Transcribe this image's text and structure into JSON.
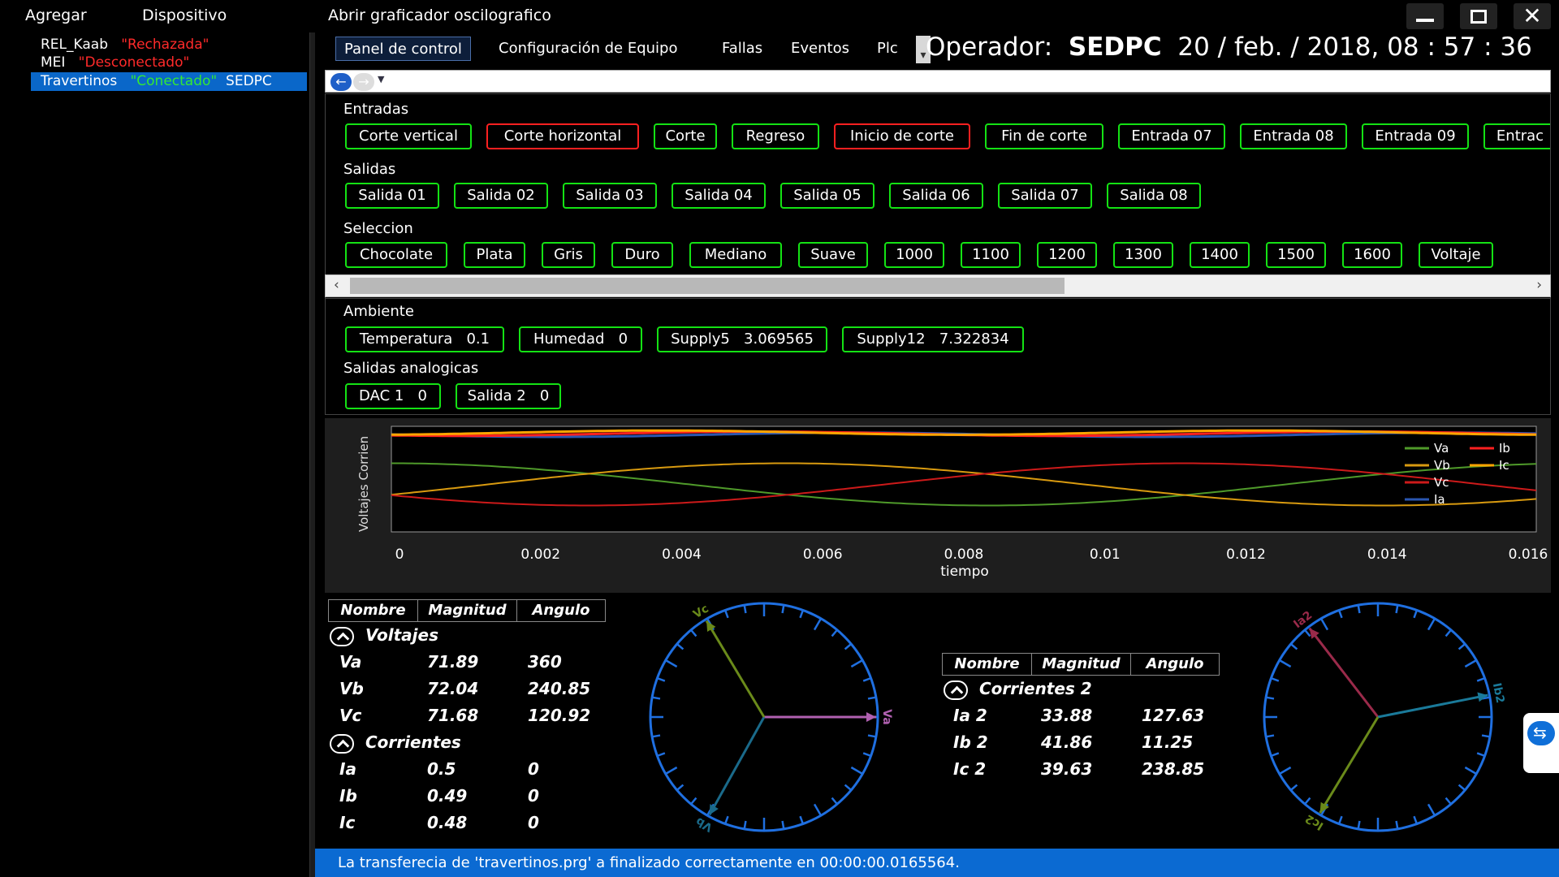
{
  "menu": {
    "items": [
      "Agregar",
      "Dispositivo",
      "Abrir graficador oscilografico"
    ]
  },
  "tree": {
    "rows": [
      {
        "name": "REL_Kaab",
        "status": "\"Rechazada\"",
        "status_color": "#ff2a2a",
        "extra": ""
      },
      {
        "name": "MEI",
        "status": "\"Desconectado\"",
        "status_color": "#ff2a2a",
        "extra": ""
      },
      {
        "name": "Travertinos",
        "status": "\"Conectado\"",
        "status_color": "#34e834",
        "extra": "SEDPC"
      }
    ]
  },
  "tabs": [
    "Panel de control",
    "Configuración de Equipo",
    "Fallas",
    "Eventos",
    "Plc"
  ],
  "header": {
    "operator_label": "Operador:",
    "operator_name": "SEDPC",
    "datetime": "20 / feb. / 2018, 08 : 57 : 36"
  },
  "nav": {
    "back_icon": "arrow-left-icon",
    "forward_icon": "arrow-right-icon"
  },
  "entradas": {
    "label": "Entradas",
    "items": [
      {
        "label": "Corte vertical",
        "state": "on"
      },
      {
        "label": "Corte horizontal",
        "state": "off"
      },
      {
        "label": "Corte",
        "state": "on"
      },
      {
        "label": "Regreso",
        "state": "on"
      },
      {
        "label": "Inicio de corte",
        "state": "off"
      },
      {
        "label": "Fin de corte",
        "state": "on"
      },
      {
        "label": "Entrada 07",
        "state": "on"
      },
      {
        "label": "Entrada 08",
        "state": "on"
      },
      {
        "label": "Entrada 09",
        "state": "on"
      },
      {
        "label": "Entrac",
        "state": "on"
      }
    ]
  },
  "salidas": {
    "label": "Salidas",
    "items": [
      "Salida 01",
      "Salida 02",
      "Salida 03",
      "Salida 04",
      "Salida 05",
      "Salida 06",
      "Salida 07",
      "Salida 08"
    ]
  },
  "seleccion": {
    "label": "Seleccion",
    "items": [
      "Chocolate",
      "Plata",
      "Gris",
      "Duro",
      "Mediano",
      "Suave",
      "1000",
      "1100",
      "1200",
      "1300",
      "1400",
      "1500",
      "1600",
      "Voltaje"
    ]
  },
  "ambiente": {
    "label": "Ambiente",
    "items": [
      {
        "name": "Temperatura",
        "value": "0.1"
      },
      {
        "name": "Humedad",
        "value": "0"
      },
      {
        "name": "Supply5",
        "value": "3.069565"
      },
      {
        "name": "Supply12",
        "value": "7.322834"
      }
    ]
  },
  "salidas_analogicas": {
    "label": "Salidas analogicas",
    "items": [
      {
        "name": "DAC 1",
        "value": "0"
      },
      {
        "name": "Salida 2",
        "value": "0"
      }
    ]
  },
  "chart_data": {
    "type": "line",
    "xlabel": "tiempo",
    "ylabel": "Voltajes Corrien",
    "xlim": [
      0,
      0.016
    ],
    "xticks": [
      "0",
      "0.002",
      "0.004",
      "0.006",
      "0.008",
      "0.01",
      "0.012",
      "0.014",
      "0.016"
    ],
    "legend": "top-right",
    "series": [
      {
        "name": "Va",
        "color": "#4f9a2a",
        "amplitude": 0.5,
        "phase_deg": 360,
        "offset": 0.45,
        "kind": "voltage"
      },
      {
        "name": "Vb",
        "color": "#d89a10",
        "amplitude": 0.5,
        "phase_deg": 240.85,
        "offset": 0.45,
        "kind": "voltage"
      },
      {
        "name": "Vc",
        "color": "#cc1a1a",
        "amplitude": 0.5,
        "phase_deg": 120.92,
        "offset": 0.45,
        "kind": "voltage"
      },
      {
        "name": "Ia",
        "color": "#2a56b0",
        "amplitude": 0.02,
        "phase_deg": 0,
        "offset": 0.92,
        "kind": "current"
      },
      {
        "name": "Ib",
        "color": "#ff2020",
        "amplitude": 0.02,
        "phase_deg": 0,
        "offset": 0.93,
        "kind": "current"
      },
      {
        "name": "Ic",
        "color": "#ffa500",
        "amplitude": 0.02,
        "phase_deg": 0,
        "offset": 0.94,
        "kind": "current"
      }
    ]
  },
  "table1": {
    "headers": [
      "Nombre",
      "Magnitud",
      "Angulo"
    ],
    "groups": [
      {
        "title": "Voltajes",
        "rows": [
          [
            "Va",
            "71.89",
            "360"
          ],
          [
            "Vb",
            "72.04",
            "240.85"
          ],
          [
            "Vc",
            "71.68",
            "120.92"
          ]
        ]
      },
      {
        "title": "Corrientes",
        "rows": [
          [
            "Ia",
            "0.5",
            "0"
          ],
          [
            "Ib",
            "0.49",
            "0"
          ],
          [
            "Ic",
            "0.48",
            "0"
          ]
        ]
      }
    ]
  },
  "table2": {
    "headers": [
      "Nombre",
      "Magnitud",
      "Angulo"
    ],
    "groups": [
      {
        "title": "Corrientes 2",
        "rows": [
          [
            "Ia 2",
            "33.88",
            "127.63"
          ],
          [
            "Ib 2",
            "41.86",
            "11.25"
          ],
          [
            "Ic 2",
            "39.63",
            "238.85"
          ]
        ]
      }
    ]
  },
  "phasor1": {
    "vectors": [
      {
        "label": "Va",
        "angle_deg": 0,
        "color": "#b060b0"
      },
      {
        "label": "Vb",
        "angle_deg": 240.85,
        "color": "#1a6a8a"
      },
      {
        "label": "Vc",
        "angle_deg": 120.92,
        "color": "#6a8a1a"
      }
    ],
    "ring_color": "#1f6fe0"
  },
  "phasor2": {
    "vectors": [
      {
        "label": "Ia2",
        "angle_deg": 127.63,
        "color": "#9a2a4a"
      },
      {
        "label": "Ib2",
        "angle_deg": 11.25,
        "color": "#1a7a9a"
      },
      {
        "label": "Ic2",
        "angle_deg": 238.85,
        "color": "#6a8a1a"
      }
    ],
    "ring_color": "#1f6fe0"
  },
  "status": {
    "message": "La transferecia de 'travertinos.prg' a finalizado correctamente en 00:00:00.0165564."
  },
  "colors": {
    "accent": "#0b6ad2",
    "chip_on": "#14e214",
    "chip_off": "#ff2020"
  }
}
